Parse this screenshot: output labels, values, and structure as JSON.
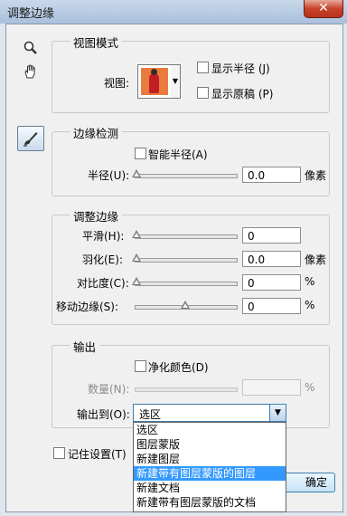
{
  "window": {
    "title": "调整边缘",
    "close_glyph": "✕"
  },
  "tools": {
    "zoom_icon": "zoom-icon",
    "hand_icon": "hand-icon",
    "refine_icon": "refine-radius-brush-icon"
  },
  "view_mode": {
    "legend": "视图模式",
    "view_label": "视图:",
    "show_radius": "显示半径 (J)",
    "show_original": "显示原稿 (P)",
    "show_radius_checked": false,
    "show_original_checked": false
  },
  "edge_detection": {
    "legend": "边缘检测",
    "smart_radius": "智能半径(A)",
    "smart_radius_checked": false,
    "radius_label": "半径(U):",
    "radius_value": "0.0",
    "radius_unit": "像素",
    "radius_slider": 0
  },
  "adjust_edge": {
    "legend": "调整边缘",
    "smooth_label": "平滑(H):",
    "smooth_value": "0",
    "smooth_slider": 0,
    "feather_label": "羽化(E):",
    "feather_value": "0.0",
    "feather_unit": "像素",
    "feather_slider": 0,
    "contrast_label": "对比度(C):",
    "contrast_value": "0",
    "contrast_unit": "%",
    "contrast_slider": 0,
    "shift_label": "移动边缘(S):",
    "shift_value": "0",
    "shift_unit": "%",
    "shift_slider": 0
  },
  "output": {
    "legend": "输出",
    "decontaminate": "净化颜色(D)",
    "decontaminate_checked": false,
    "amount_label": "数量(N):",
    "amount_unit": "%",
    "output_to_label": "输出到(O):",
    "output_to_value": "选区",
    "options": [
      "选区",
      "图层蒙版",
      "新建图层",
      "新建带有图层蒙版的图层",
      "新建文档",
      "新建带有图层蒙版的文档"
    ],
    "highlighted_index": 3
  },
  "remember": {
    "label": "记住设置(T)",
    "checked": false
  },
  "buttons": {
    "ok_label": "确定"
  }
}
